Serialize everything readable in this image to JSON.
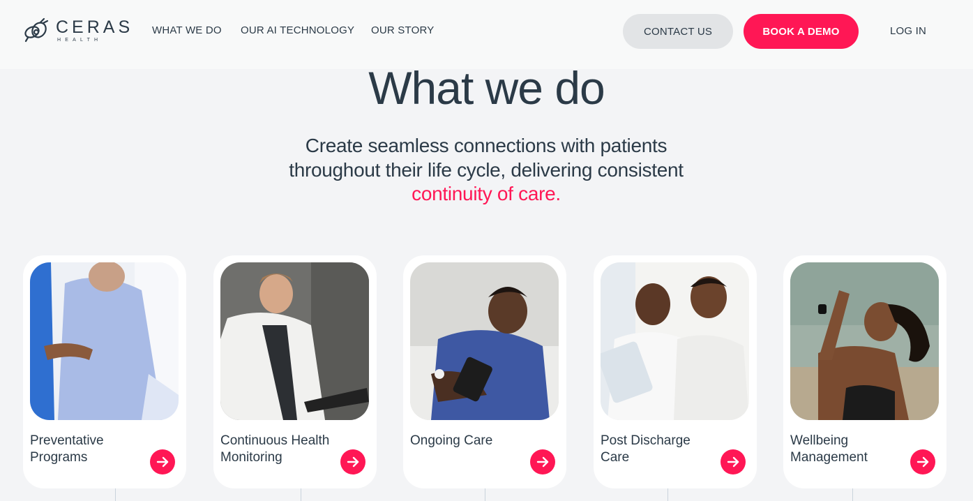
{
  "brand": {
    "name": "CERAS",
    "tagline": "HEALTH"
  },
  "nav": {
    "links": [
      "WHAT WE DO",
      "OUR AI TECHNOLOGY",
      "OUR STORY"
    ],
    "contact_label": "CONTACT US",
    "demo_label": "BOOK A DEMO",
    "login_label": "LOG IN"
  },
  "hero": {
    "title": "What we do",
    "subtitle_line1": "Create seamless connections with patients",
    "subtitle_line2": "throughout their life cycle, delivering consistent",
    "subtitle_accent": "continuity of care."
  },
  "cards": [
    {
      "label": "Preventative Programs",
      "icon": "arrow-right-icon"
    },
    {
      "label": "Continuous Health Monitoring",
      "icon": "arrow-right-icon"
    },
    {
      "label": "Ongoing Care",
      "icon": "arrow-right-icon"
    },
    {
      "label": "Post Discharge Care",
      "icon": "arrow-right-icon"
    },
    {
      "label": "Wellbeing Management",
      "icon": "arrow-right-icon"
    }
  ],
  "colors": {
    "accent": "#ff1755",
    "text": "#2b3a47",
    "background": "#f3f4f6",
    "contact_button": "#e2e4e6"
  }
}
